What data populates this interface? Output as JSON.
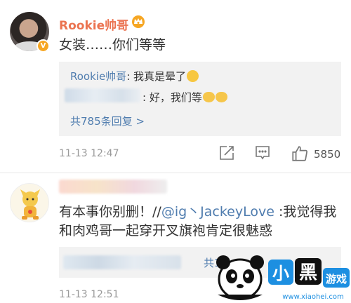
{
  "comment1": {
    "author": "Rookie帅哥",
    "text": "女装……你们等等",
    "replies": [
      {
        "author": "Rookie帅哥",
        "text": ": 我真是晕了"
      },
      {
        "author": "",
        "text": ": 好，我们等"
      }
    ],
    "more_replies": "共785条回复 >",
    "time": "11-13 12:47",
    "likes": "5850"
  },
  "comment2": {
    "text_part1": "有本事你别删！//",
    "mention": "@ig丶JackeyLove",
    "text_part2": " :我觉得我和肉鸡哥一起穿开叉旗袍肯定很魅惑",
    "more_replies": "共13",
    "time": "11-13 12:51"
  },
  "watermark": {
    "text": "小黑游戏",
    "url": "www.xiaohei.com"
  },
  "icons": {
    "repost": "share-icon",
    "comment": "comment-icon",
    "like": "thumbs-up-icon",
    "verified": "verified-badge-icon",
    "crown": "crown-icon"
  },
  "colors": {
    "username": "#eb7350",
    "link": "#507daf",
    "muted": "#9a9a9a",
    "reply_bg": "#f2f2f2"
  }
}
